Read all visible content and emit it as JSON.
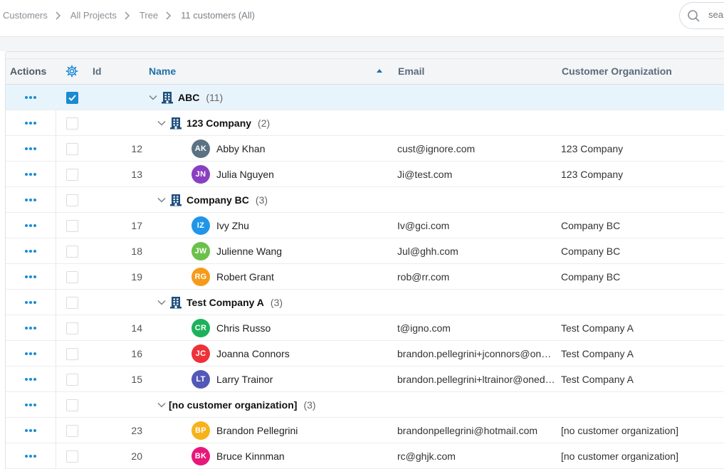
{
  "breadcrumbs": [
    "Customers",
    "All Projects",
    "Tree",
    "11 customers (All)"
  ],
  "search": {
    "placeholder": "search"
  },
  "columns": {
    "actions": "Actions",
    "id": "Id",
    "name": "Name",
    "email": "Email",
    "organization": "Customer Organization",
    "settings_icon": "gear-icon",
    "sort_icon": "sort-ascending-icon"
  },
  "colors": {
    "accent": "#1a8ad4",
    "selected_row": "#e8f4fb",
    "header_bg": "#f4f5f7"
  },
  "rows": [
    {
      "type": "group",
      "level": 0,
      "name": "ABC",
      "count": "(11)",
      "selected": true
    },
    {
      "type": "group",
      "level": 1,
      "name": "123 Company",
      "count": "(2)",
      "selected": false
    },
    {
      "type": "person",
      "id": "12",
      "initials": "AK",
      "avatar_color": "#5b7282",
      "name": "Abby Khan",
      "email": "cust@ignore.com",
      "org": "123 Company"
    },
    {
      "type": "person",
      "id": "13",
      "initials": "JN",
      "avatar_color": "#8a3fc1",
      "name": "Julia Nguyen",
      "email": "Ji@test.com",
      "org": "123 Company"
    },
    {
      "type": "group",
      "level": 1,
      "name": "Company BC",
      "count": "(3)",
      "selected": false
    },
    {
      "type": "person",
      "id": "17",
      "initials": "IZ",
      "avatar_color": "#2196e8",
      "name": "Ivy Zhu",
      "email": "Iv@gci.com",
      "org": "Company BC"
    },
    {
      "type": "person",
      "id": "18",
      "initials": "JW",
      "avatar_color": "#6cc04a",
      "name": "Julienne Wang",
      "email": "Jul@ghh.com",
      "org": "Company BC"
    },
    {
      "type": "person",
      "id": "19",
      "initials": "RG",
      "avatar_color": "#f59b1a",
      "name": "Robert Grant",
      "email": "rob@rr.com",
      "org": "Company BC"
    },
    {
      "type": "group",
      "level": 1,
      "name": "Test Company A",
      "count": "(3)",
      "selected": false
    },
    {
      "type": "person",
      "id": "14",
      "initials": "CR",
      "avatar_color": "#1db25a",
      "name": "Chris Russo",
      "email": "t@igno.com",
      "org": "Test Company A"
    },
    {
      "type": "person",
      "id": "16",
      "initials": "JC",
      "avatar_color": "#ee3138",
      "name": "Joanna Connors",
      "email": "brandon.pellegrini+jconnors@one…",
      "org": "Test Company A"
    },
    {
      "type": "person",
      "id": "15",
      "initials": "LT",
      "avatar_color": "#5358b8",
      "name": "Larry Trainor",
      "email": "brandon.pellegrini+ltrainor@oned…",
      "org": "Test Company A"
    },
    {
      "type": "group",
      "level": 1,
      "name": "[no customer organization]",
      "count": "(3)",
      "selected": false,
      "noicon": true
    },
    {
      "type": "person",
      "id": "23",
      "initials": "BP",
      "avatar_color": "#f7b21b",
      "name": "Brandon Pellegrini",
      "email": "brandonpellegrini@hotmail.com",
      "org": "[no customer organization]"
    },
    {
      "type": "person",
      "id": "20",
      "initials": "BK",
      "avatar_color": "#e8177a",
      "name": "Bruce Kinnman",
      "email": "rc@ghjk.com",
      "org": "[no customer organization]"
    }
  ]
}
